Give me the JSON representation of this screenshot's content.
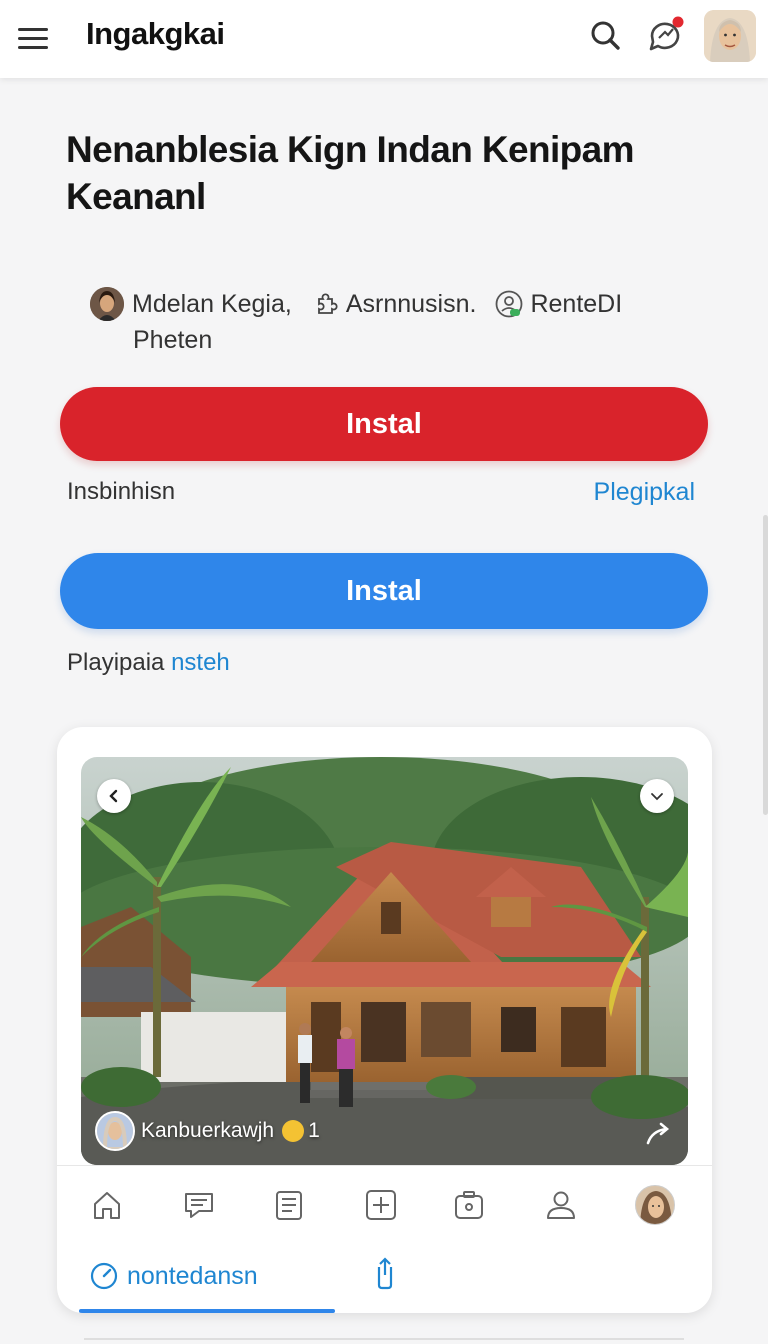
{
  "header": {
    "app_title": "Ingakgkai",
    "menu_icon": "hamburger-menu-icon",
    "search_icon": "search-icon",
    "notification_icon": "chat-bubble-icon",
    "profile": "user-avatar"
  },
  "article": {
    "title": "Nenanblesia Kign Indan Kenipam Keananl",
    "meta": {
      "author": "Mdelan Kegia,",
      "category": "Asrnnusisn.",
      "status": "RenteDI",
      "sub": "Pheten"
    }
  },
  "actions": {
    "primary_install": "Instal",
    "row1_left": "Insbinhisn",
    "row1_link": "Plegipkal",
    "secondary_install": "Instal",
    "row2_prefix": "Playipaia ",
    "row2_link": "nsteh"
  },
  "card": {
    "caption_user": "Kanbuerkawjh",
    "caption_count": "1",
    "nav": [
      "home-icon",
      "message-icon",
      "list-icon",
      "add-icon",
      "camera-icon",
      "profile-icon",
      "avatar"
    ],
    "tab_active_label": "nontedansn"
  },
  "colors": {
    "primary_red": "#d9232b",
    "primary_blue": "#2f86ea",
    "link_blue": "#1f86d1"
  }
}
